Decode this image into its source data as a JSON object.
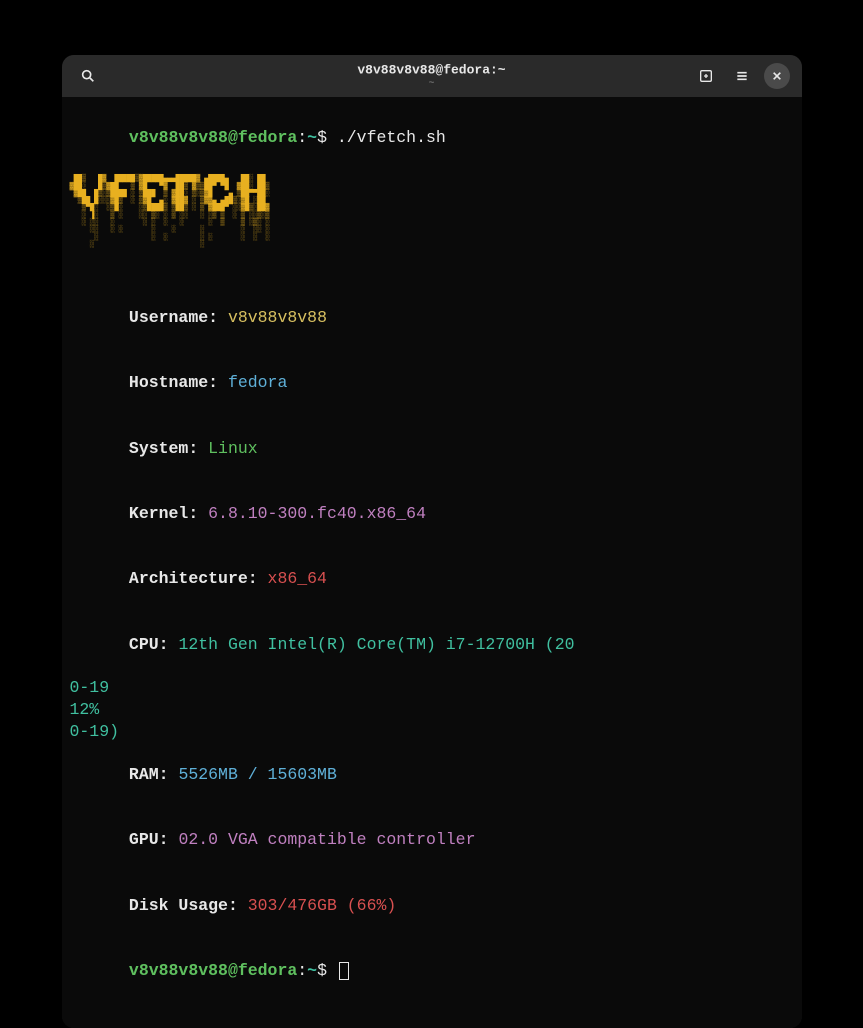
{
  "titlebar": {
    "title": "v8v88v8v88@fedora:~",
    "subtitle": "~"
  },
  "prompt": {
    "userhost": "v8v88v8v88@fedora",
    "sep": ":",
    "path": "~",
    "dollar": "$ ",
    "command": "./vfetch.sh"
  },
  "ascii_logo": " ██▒   █▓  █████▒▓█████▄▄▄█████▓ ▄████▄   ██░ ██ \n▓██░   █▒▓██   ▒ ▓█   ▀▓  ██▒ ▓▒▒██▀ ▀█  ▓██░ ██▒\n ▓██  █▒░▒████ ░ ▒███  ▒ ▓██░ ▒░▒▓█    ▄ ▒██▀▀██░\n  ▒██ █░░░▓█▒  ░ ▒▓█  ▄░ ▓██▓ ░ ▒▓▓▄ ▄██▒░▓█ ░██ \n   ▒▀█░  ░▒█░    ░▒████▒ ▒██▒ ░ ▒ ▓███▀ ░░▓█▒░██▓\n   ░ ▐░   ▒ ░    ░░ ▒░ ░ ▒ ░░   ░ ░▒ ▒  ░ ▒ ░░▒░▒\n   ░ ░░   ░       ░ ░  ░   ░      ░  ▒    ▒ ░▒░ ░\n     ░░   ░ ░       ░    ░      ░         ░  ░░ ░\n      ░             ░  ░        ░ ░       ░  ░  ░\n     ░                          ░                ",
  "info": {
    "username_label": "Username: ",
    "username_value": "v8v88v8v88",
    "hostname_label": "Hostname: ",
    "hostname_value": "fedora",
    "system_label": "System: ",
    "system_value": "Linux",
    "kernel_label": "Kernel: ",
    "kernel_value": "6.8.10-300.fc40.x86_64",
    "arch_label": "Architecture: ",
    "arch_value": "x86_64",
    "cpu_label": "CPU: ",
    "cpu_value": "12th Gen Intel(R) Core(TM) i7-12700H (20",
    "cpu_line2": "0-19",
    "cpu_line3": "12%",
    "cpu_line4": "0-19)",
    "ram_label": "RAM: ",
    "ram_value": "5526MB / 15603MB",
    "gpu_label": "GPU: ",
    "gpu_value": "02.0 VGA compatible controller",
    "disk_label": "Disk Usage: ",
    "disk_value": "303/476GB (66%)"
  },
  "prompt2": {
    "userhost": "v8v88v8v88@fedora",
    "sep": ":",
    "path": "~",
    "dollar": "$ "
  }
}
